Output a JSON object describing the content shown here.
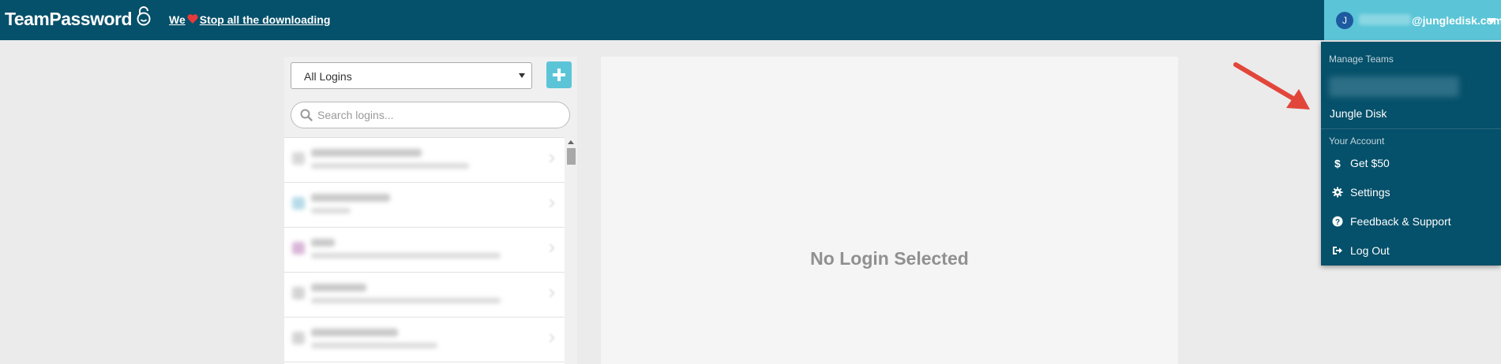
{
  "header": {
    "brand": "TeamPassword",
    "promo_prefix": "We",
    "promo_text": "Stop all the downloading",
    "user_initial": "J",
    "user_email": "@jungledisk.com"
  },
  "sidebar": {
    "filter_selected": "All Logins",
    "search_placeholder": "Search logins..."
  },
  "main": {
    "empty_message": "No Login Selected"
  },
  "user_menu": {
    "manage_teams_label": "Manage Teams",
    "team_name": "Jungle Disk",
    "your_account_label": "Your Account",
    "items": [
      {
        "label": "Get $50",
        "icon": "dollar-icon"
      },
      {
        "label": "Settings",
        "icon": "gear-icon"
      },
      {
        "label": "Feedback & Support",
        "icon": "question-circle-icon"
      },
      {
        "label": "Log Out",
        "icon": "sign-out-icon"
      }
    ]
  },
  "colors": {
    "header_bg": "#05506a",
    "accent": "#5bc5d7",
    "page_bg": "#ebebeb",
    "annotation": "#e2463b"
  }
}
